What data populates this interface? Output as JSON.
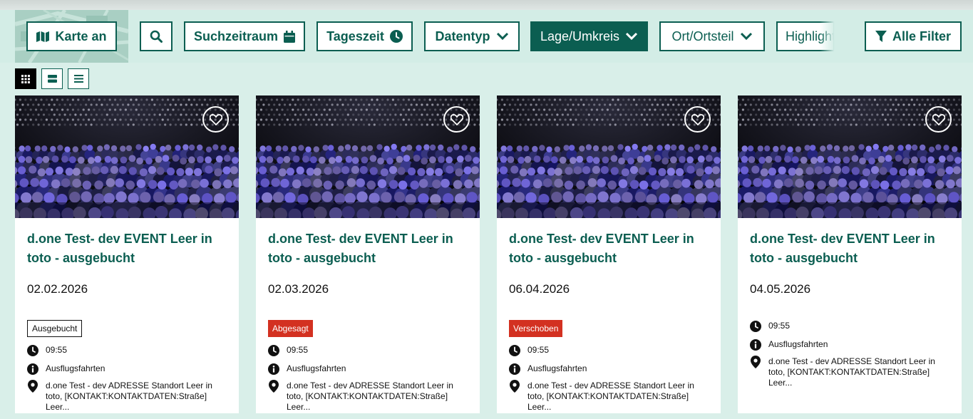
{
  "toolbar": {
    "map_button": "Karte an",
    "search_button_icon": "search-icon",
    "period": "Suchzeitraum",
    "daytime": "Tageszeit",
    "datatype": "Datentyp",
    "location": "Lage/Umkreis",
    "district": "Ort/Ortsteil",
    "highlights": "Highlights",
    "all_filters": "Alle Filter"
  },
  "view_modes": [
    "grid-view-icon",
    "tile-view-icon",
    "list-view-icon"
  ],
  "colors": {
    "brand": "#0b5e51",
    "cancelled": "#d33121",
    "background": "#d9efe9"
  },
  "cards": [
    {
      "title": "d.one Test- dev EVENT Leer in toto - ausgebucht",
      "date": "02.02.2026",
      "status": "Ausgebucht",
      "time": "09:55",
      "category": "Ausflugsfahrten",
      "address": "d.one Test - dev ADRESSE Standort Leer in toto, [KONTAKT:KONTAKTDATEN:Straße] Leer..."
    },
    {
      "title": "d.one Test- dev EVENT Leer in toto - ausgebucht",
      "date": "02.03.2026",
      "status": "Abgesagt",
      "time": "09:55",
      "category": "Ausflugsfahrten",
      "address": "d.one Test - dev ADRESSE Standort Leer in toto, [KONTAKT:KONTAKTDATEN:Straße] Leer..."
    },
    {
      "title": "d.one Test- dev EVENT Leer in toto - ausgebucht",
      "date": "06.04.2026",
      "status": "Verschoben",
      "time": "09:55",
      "category": "Ausflugsfahrten",
      "address": "d.one Test - dev ADRESSE Standort Leer in toto, [KONTAKT:KONTAKTDATEN:Straße] Leer..."
    },
    {
      "title": "d.one Test- dev EVENT Leer in toto - ausgebucht",
      "date": "04.05.2026",
      "status": "",
      "time": "09:55",
      "category": "Ausflugsfahrten",
      "address": "d.one Test - dev ADRESSE Standort Leer in toto, [KONTAKT:KONTAKTDATEN:Straße] Leer..."
    }
  ]
}
